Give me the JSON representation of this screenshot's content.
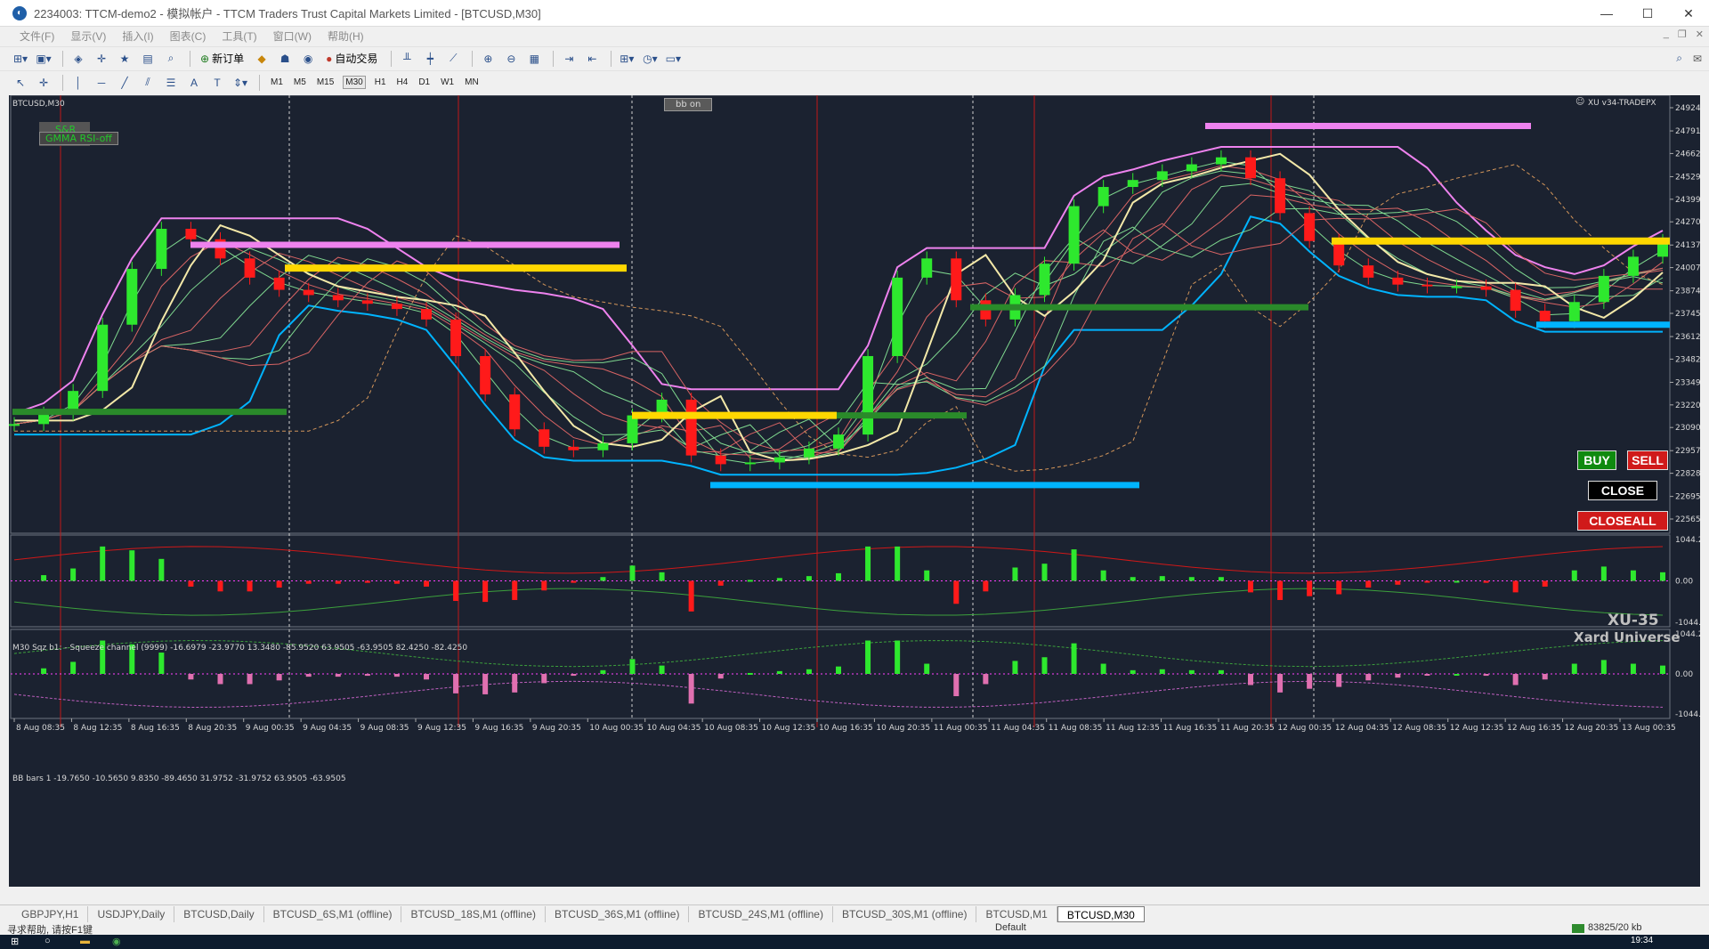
{
  "window": {
    "title": "2234003: TTCM-demo2 - 模拟帐户 - TTCM Traders Trust Capital Markets Limited - [BTCUSD,M30]",
    "controls": [
      "—",
      "☐",
      "✕"
    ]
  },
  "menu": [
    "文件(F)",
    "显示(V)",
    "插入(I)",
    "图表(C)",
    "工具(T)",
    "窗口(W)",
    "帮助(H)"
  ],
  "toolbar": {
    "new_order_label": "新订单",
    "auto_trade_label": "自动交易"
  },
  "timeframes": [
    "M1",
    "M5",
    "M15",
    "M30",
    "H1",
    "H4",
    "D1",
    "W1",
    "MN"
  ],
  "active_timeframe": "M30",
  "chart": {
    "symbol_label": "BTCUSD,M30",
    "bb_button": "bb on",
    "sr_label": "S&R",
    "gmma_label": "GMMA RSI-off",
    "ea_label": "XU v34-TRADEPX",
    "brand_title": "XU-35",
    "brand_subtitle": "Xard Universe",
    "squeeze_label": "M30 Sqz b1: - Squeeze channel (9999) -16.6979 -23.9770 13.3480 -85.9520 63.9505 -63.9505 82.4250 -82.4250",
    "bbbars_label": "BB bars 1 -19.7650 -10.5650 9.8350 -89.4650 31.9752 -31.9752 63.9505 -63.9505"
  },
  "trade_buttons": {
    "buy": "BUY",
    "sell": "SELL",
    "close": "CLOSE",
    "closeall": "CLOSEALL"
  },
  "colors": {
    "background": "#1b2230",
    "bull": "#2ee82e",
    "bear": "#ff1a1a",
    "neutral": "#9a9a9a",
    "support": "#00b4ff",
    "resistance": "#ee82ee",
    "level_yellow": "#ffd700",
    "level_green": "#2a8a2a"
  },
  "chart_data": {
    "type": "line",
    "title": "BTCUSD,M30",
    "price_axis": [
      "24924.5",
      "24791.5",
      "24662.0",
      "24529.0",
      "24399.5",
      "24270.0",
      "24137.0",
      "24007.5",
      "23874.5",
      "23745.0",
      "23612.0",
      "23482.5",
      "23349.5",
      "23220.0",
      "23090.5",
      "22957.5",
      "22828.0",
      "22695.0",
      "22565.5"
    ],
    "ylim": [
      22565.5,
      24924.5
    ],
    "indicator_axis": [
      "1044.25",
      "0.00",
      "-1044.25"
    ],
    "indicator2_axis": [
      "1044.25",
      "0.00",
      "-1044.25"
    ],
    "time_labels": [
      "8 Aug 08:35",
      "8 Aug 12:35",
      "8 Aug 16:35",
      "8 Aug 20:35",
      "9 Aug 00:35",
      "9 Aug 04:35",
      "9 Aug 08:35",
      "9 Aug 12:35",
      "9 Aug 16:35",
      "9 Aug 20:35",
      "10 Aug 00:35",
      "10 Aug 04:35",
      "10 Aug 08:35",
      "10 Aug 12:35",
      "10 Aug 16:35",
      "10 Aug 20:35",
      "11 Aug 00:35",
      "11 Aug 04:35",
      "11 Aug 08:35",
      "11 Aug 12:35",
      "11 Aug 16:35",
      "11 Aug 20:35",
      "12 Aug 00:35",
      "12 Aug 04:35",
      "12 Aug 08:35",
      "12 Aug 12:35",
      "12 Aug 16:35",
      "12 Aug 20:35",
      "13 Aug 00:35"
    ],
    "series": [
      {
        "name": "BTCUSD,M30",
        "values": [
          23110,
          23170,
          23300,
          23680,
          24000,
          24230,
          24170,
          24060,
          23950,
          23880,
          23850,
          23820,
          23800,
          23770,
          23710,
          23500,
          23280,
          23080,
          22980,
          22960,
          23000,
          23160,
          23250,
          22930,
          22880,
          22890,
          22920,
          22970,
          23050,
          23500,
          23950,
          24060,
          23820,
          23710,
          23850,
          24030,
          24360,
          24470,
          24510,
          24560,
          24600,
          24640,
          24520,
          24320,
          24160,
          24020,
          23950,
          23910,
          23900,
          23900,
          23880,
          23760,
          23700,
          23810,
          23960,
          24070,
          24160
        ]
      }
    ],
    "support_levels": [
      22760,
      23680
    ],
    "resistance_levels": [
      24138,
      24820
    ],
    "yellow_levels": [
      24005,
      23160,
      24160
    ],
    "green_levels": [
      23180,
      23780,
      23160
    ]
  },
  "tabs": [
    "GBPJPY,H1",
    "USDJPY,Daily",
    "BTCUSD,Daily",
    "BTCUSD_6S,M1 (offline)",
    "BTCUSD_18S,M1 (offline)",
    "BTCUSD_36S,M1 (offline)",
    "BTCUSD_24S,M1 (offline)",
    "BTCUSD_30S,M1 (offline)",
    "BTCUSD,M1",
    "BTCUSD,M30"
  ],
  "active_tab": "BTCUSD,M30",
  "status": {
    "help": "寻求帮助, 请按F1键",
    "profile": "Default",
    "traffic": "83825/20 kb",
    "time": "19:34"
  }
}
